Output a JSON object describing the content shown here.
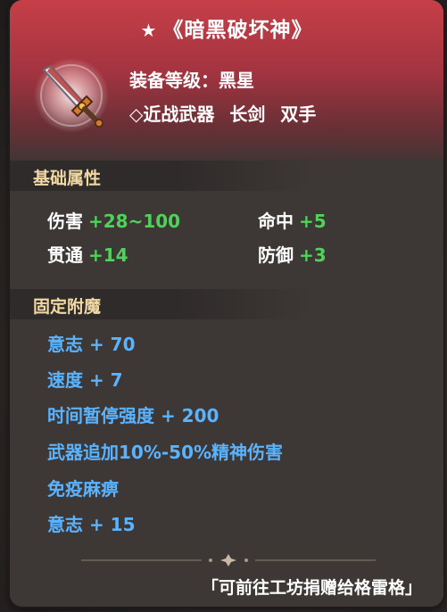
{
  "item": {
    "star": "★",
    "name": "《暗黑破坏神》",
    "level_label": "装备等级：黑星",
    "type_tags": [
      "◇近战武器",
      "长剑",
      "双手"
    ],
    "icon": "sword-icon"
  },
  "base_section": {
    "title": "基础属性",
    "stats": [
      {
        "name": "伤害",
        "value": "+28~100"
      },
      {
        "name": "命中",
        "value": "+5"
      },
      {
        "name": "贯通",
        "value": "+14"
      },
      {
        "name": "防御",
        "value": "+3"
      }
    ]
  },
  "enchant_section": {
    "title": "固定附魔",
    "lines": [
      "意志 + 70",
      "速度 + 7",
      "时间暂停强度 + 200",
      "武器追加10%-50%精神伤害",
      "免疫麻痹",
      "意志 + 15"
    ]
  },
  "footer": {
    "note": "「可前往工坊捐赠给格雷格」"
  },
  "colors": {
    "header_red": "#c63f48",
    "section_title": "#f2d9a4",
    "stat_value_green": "#4fd15a",
    "enchant_blue": "#5ab3ff"
  }
}
